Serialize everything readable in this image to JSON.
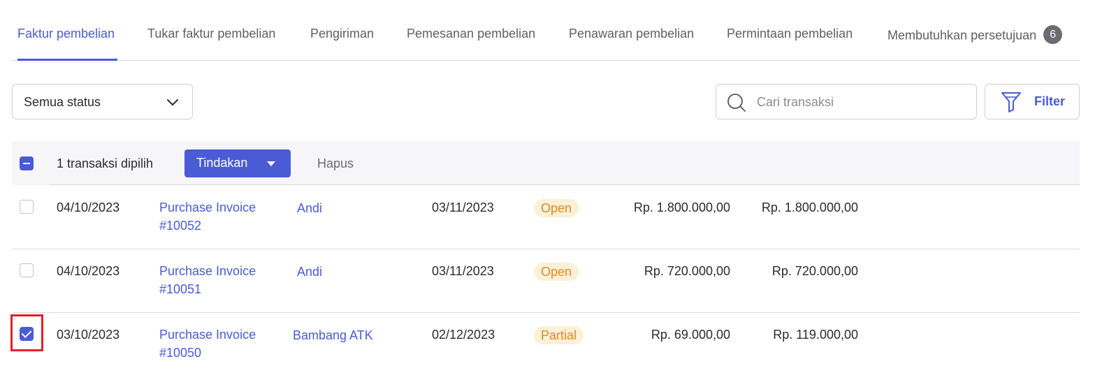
{
  "tabs": [
    {
      "label": "Faktur pembelian",
      "active": true
    },
    {
      "label": "Tukar faktur pembelian"
    },
    {
      "label": "Pengiriman"
    },
    {
      "label": "Pemesanan pembelian"
    },
    {
      "label": "Penawaran pembelian"
    },
    {
      "label": "Permintaan pembelian"
    },
    {
      "label": "Membutuhkan persetujuan",
      "badge": "6"
    }
  ],
  "toolbar": {
    "status_select": "Semua status",
    "search_placeholder": "Cari transaksi",
    "filter_label": "Filter"
  },
  "bulk": {
    "selected_text": "1 transaksi dipilih",
    "actions_label": "Tindakan",
    "delete_label": "Hapus"
  },
  "rows": [
    {
      "date": "04/10/2023",
      "invoice": "Purchase Invoice #10052",
      "vendor": "Andi",
      "due_date": "03/11/2023",
      "status": "Open",
      "balance": "Rp. 1.800.000,00",
      "total": "Rp. 1.800.000,00",
      "checked": false
    },
    {
      "date": "04/10/2023",
      "invoice": "Purchase Invoice #10051",
      "vendor": "Andi",
      "due_date": "03/11/2023",
      "status": "Open",
      "balance": "Rp. 720.000,00",
      "total": "Rp. 720.000,00",
      "checked": false
    },
    {
      "date": "03/10/2023",
      "invoice": "Purchase Invoice #10050",
      "vendor": "Bambang ATK",
      "due_date": "02/12/2023",
      "status": "Partial",
      "balance": "Rp. 69.000,00",
      "total": "Rp. 119.000,00",
      "checked": true
    }
  ],
  "colors": {
    "accent": "#4a5bd6",
    "status_bg": "#fdf0d8",
    "status_text": "#e08a1e",
    "highlight": "#e2202a"
  },
  "icons": {
    "dropdown": "chevron-down-icon",
    "search": "search-icon",
    "filter": "funnel-icon",
    "actions": "caret-down-icon"
  }
}
